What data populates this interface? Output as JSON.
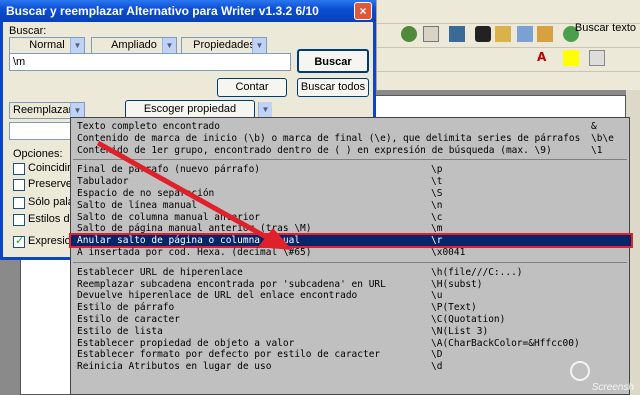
{
  "dialog": {
    "title": "Buscar y reemplazar Alternativo para Writer v1.3.2  6/10",
    "close_label": "×",
    "search_label": "Buscar:",
    "search_modes": [
      "Normal",
      "Ampliado",
      "Propiedades"
    ],
    "search_value": "\\m",
    "buscar_button": "Buscar",
    "contar_button": "Contar",
    "buscar_todos_button": "Buscar todos",
    "reemplazar_label": "Reemplazar:",
    "escoger_button": "Escoger propiedad",
    "opciones_label": "Opciones:",
    "options": [
      {
        "label": "Coincidir m",
        "checked": false
      },
      {
        "label": "Preserve c",
        "checked": false
      },
      {
        "label": "Sólo palab",
        "checked": false
      },
      {
        "label": "Estilos de p",
        "checked": false
      },
      {
        "label": "Expresione",
        "checked": true
      }
    ]
  },
  "toolbar": {
    "search_text_label": "Buscar texto"
  },
  "dropdown": {
    "groups": [
      [
        {
          "desc": "Texto completo encontrado",
          "code": "&"
        },
        {
          "desc": "Contenido de marca de inicio (\\b) o marca de final (\\e), que delimita series de párrafos",
          "code": "\\b\\e"
        },
        {
          "desc": "Contenido de 1er grupo, encontrado dentro de ( ) en expresión de búsqueda (max. \\9)",
          "code": "\\1"
        }
      ],
      [
        {
          "desc": "Final de párrafo (nuevo párrafo)",
          "code": "\\p"
        },
        {
          "desc": "Tabulador",
          "code": "\\t"
        },
        {
          "desc": "Espacio de no separación",
          "code": "\\S"
        },
        {
          "desc": "Salto de línea manual",
          "code": "\\n"
        },
        {
          "desc": "Salto de columna manual anterior",
          "code": "\\c"
        },
        {
          "desc": "Salto de página manual anterior (tras \\M)",
          "code": "\\m"
        },
        {
          "desc": "Anular salto de página o columna manual",
          "code": "\\r",
          "selected": true
        },
        {
          "desc": "A insertada por cod. Hexa. (decimal \\#65)",
          "code": "\\x0041"
        }
      ],
      [
        {
          "desc": "Establecer URL de hiperenlace",
          "code": "\\h(file///C:...)"
        },
        {
          "desc": "Reemplazar subcadena encontrada por 'subcadena' en URL",
          "code": "\\H(subst)"
        },
        {
          "desc": "Devuelve hiperenlace de URL del enlace encontrado",
          "code": "\\u"
        },
        {
          "desc": "Estilo de párrafo",
          "code": "\\P(Text)"
        },
        {
          "desc": "Estilo de caracter",
          "code": "\\C(Quotation)"
        },
        {
          "desc": "Estilo de lista",
          "code": "\\N(List 3)"
        },
        {
          "desc": "Establecer propiedad de objeto a valor",
          "code": "\\A(CharBackColor=&Hffcc00)"
        },
        {
          "desc": "Establecer formato por defecto por estilo de caracter",
          "code": "\\D"
        },
        {
          "desc": "Reinicia Atributos en lugar de uso",
          "code": "\\d"
        }
      ]
    ]
  },
  "watermark": "Screensh",
  "colors": {
    "title_bar": "#0a4fd4",
    "selection": "#0a246a",
    "highlight_border": "#e0202a",
    "arrow": "#e0202a"
  }
}
